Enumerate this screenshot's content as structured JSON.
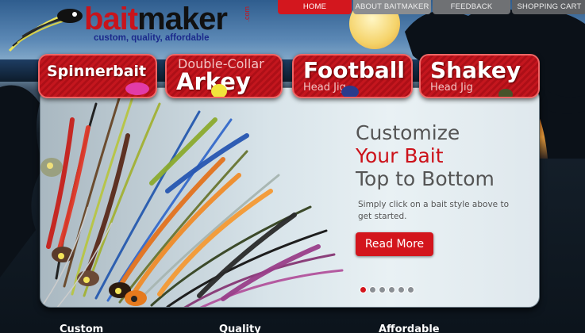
{
  "logo": {
    "word_a": "bait",
    "word_b": "maker",
    "dotcom": ".com",
    "tagline": "custom, quality, affordable"
  },
  "nav": {
    "home": "HOME",
    "about": "ABOUT BAITMAKER",
    "feedback": "FEEDBACK",
    "cart": "SHOPPING CART"
  },
  "categories": [
    {
      "big": "Spinnerbait",
      "small": ""
    },
    {
      "big": "Arkey",
      "small": "Double-Collar"
    },
    {
      "big": "Football",
      "small": "Head Jig"
    },
    {
      "big": "Shakey",
      "small": "Head Jig"
    }
  ],
  "hero": {
    "line1": "Customize",
    "line2": "Your Bait",
    "line3": "Top to Bottom",
    "description": "Simply click on a bait style above to get started.",
    "cta": "Read More"
  },
  "slider": {
    "count": 6,
    "active_index": 0
  },
  "footer": {
    "col1": "Custom",
    "col2": "Quality",
    "col3": "Affordable"
  },
  "colors": {
    "brand_red": "#d3151c",
    "logo_blue": "#1b2a8c"
  }
}
